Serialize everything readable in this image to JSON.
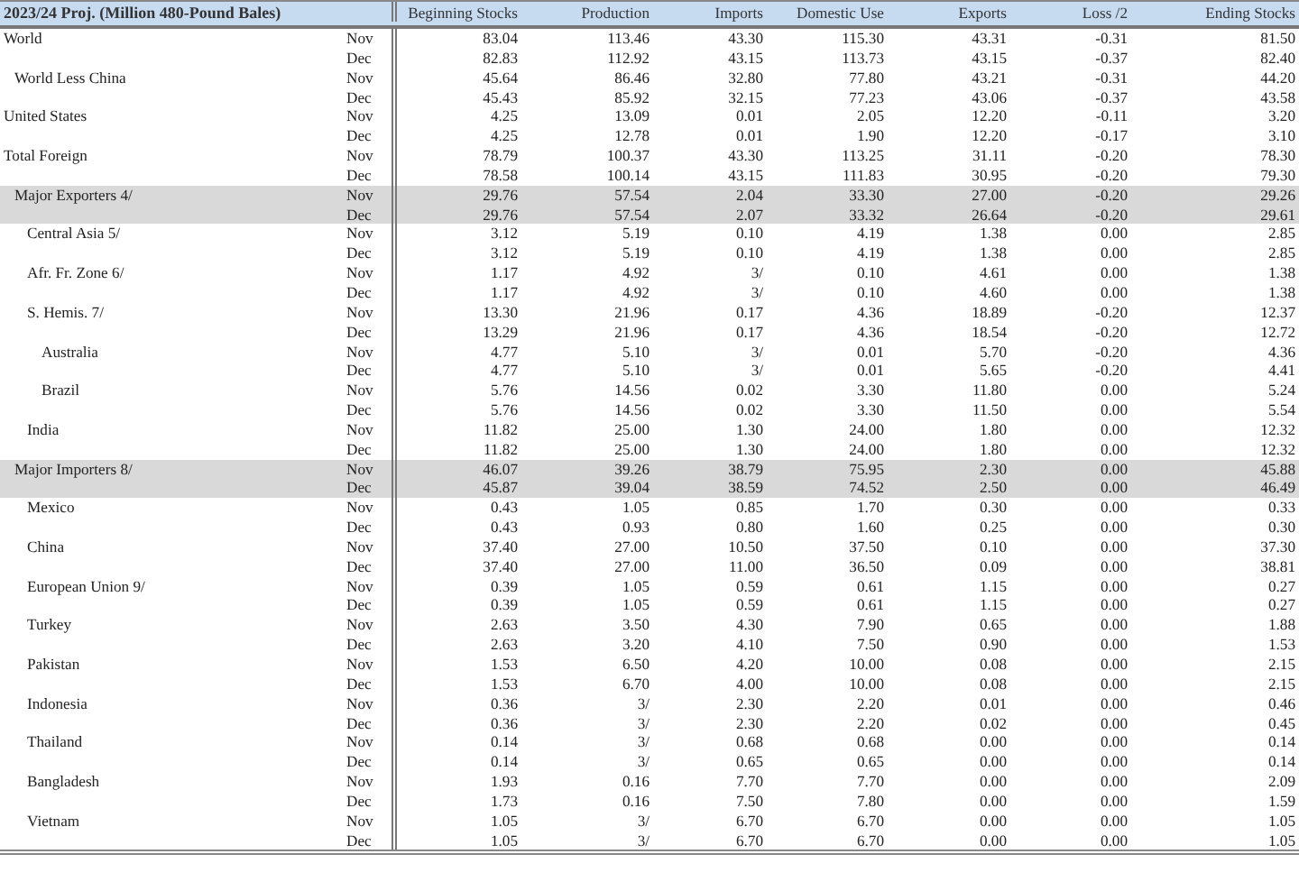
{
  "table": {
    "title": "2023/24 Proj. (Million 480-Pound Bales)",
    "columns": [
      "Beginning Stocks",
      "Production",
      "Imports",
      "Domestic Use",
      "Exports",
      "Loss /2",
      "Ending Stocks"
    ],
    "groups": [
      {
        "name": "World",
        "highlighted": false,
        "rows": [
          {
            "month": "Nov",
            "values": [
              "83.04",
              "113.46",
              "43.30",
              "115.30",
              "43.31",
              "-0.31",
              "81.50"
            ]
          },
          {
            "month": "Dec",
            "values": [
              "82.83",
              "112.92",
              "43.15",
              "113.73",
              "43.15",
              "-0.37",
              "82.40"
            ]
          }
        ],
        "children": [
          {
            "name": "World Less China",
            "highlighted": false,
            "rows": [
              {
                "month": "Nov",
                "values": [
                  "45.64",
                  "86.46",
                  "32.80",
                  "77.80",
                  "43.21",
                  "-0.31",
                  "44.20"
                ]
              },
              {
                "month": "Dec",
                "values": [
                  "45.43",
                  "85.92",
                  "32.15",
                  "77.23",
                  "43.06",
                  "-0.37",
                  "43.58"
                ]
              }
            ]
          }
        ]
      },
      {
        "name": "United States",
        "highlighted": false,
        "rows": [
          {
            "month": "Nov",
            "values": [
              "4.25",
              "13.09",
              "0.01",
              "2.05",
              "12.20",
              "-0.11",
              "3.20"
            ]
          },
          {
            "month": "Dec",
            "values": [
              "4.25",
              "12.78",
              "0.01",
              "1.90",
              "12.20",
              "-0.17",
              "3.10"
            ]
          }
        ]
      },
      {
        "name": "Total Foreign",
        "highlighted": false,
        "rows": [
          {
            "month": "Nov",
            "values": [
              "78.79",
              "100.37",
              "43.30",
              "113.25",
              "31.11",
              "-0.20",
              "78.30"
            ]
          },
          {
            "month": "Dec",
            "values": [
              "78.58",
              "100.14",
              "43.15",
              "111.83",
              "30.95",
              "-0.20",
              "79.30"
            ]
          }
        ],
        "children": [
          {
            "name": "Major Exporters  4/",
            "highlighted": true,
            "rows": [
              {
                "month": "Nov",
                "values": [
                  "29.76",
                  "57.54",
                  "2.04",
                  "33.30",
                  "27.00",
                  "-0.20",
                  "29.26"
                ]
              },
              {
                "month": "Dec",
                "values": [
                  "29.76",
                  "57.54",
                  "2.07",
                  "33.32",
                  "26.64",
                  "-0.20",
                  "29.61"
                ]
              }
            ],
            "children": [
              {
                "name": "Central Asia  5/",
                "highlighted": false,
                "rows": [
                  {
                    "month": "Nov",
                    "values": [
                      "3.12",
                      "5.19",
                      "0.10",
                      "4.19",
                      "1.38",
                      "0.00",
                      "2.85"
                    ]
                  },
                  {
                    "month": "Dec",
                    "values": [
                      "3.12",
                      "5.19",
                      "0.10",
                      "4.19",
                      "1.38",
                      "0.00",
                      "2.85"
                    ]
                  }
                ]
              },
              {
                "name": "Afr. Fr. Zone  6/",
                "highlighted": false,
                "rows": [
                  {
                    "month": "Nov",
                    "values": [
                      "1.17",
                      "4.92",
                      "3/",
                      "0.10",
                      "4.61",
                      "0.00",
                      "1.38"
                    ]
                  },
                  {
                    "month": "Dec",
                    "values": [
                      "1.17",
                      "4.92",
                      "3/",
                      "0.10",
                      "4.60",
                      "0.00",
                      "1.38"
                    ]
                  }
                ]
              },
              {
                "name": "S. Hemis.  7/",
                "highlighted": false,
                "rows": [
                  {
                    "month": "Nov",
                    "values": [
                      "13.30",
                      "21.96",
                      "0.17",
                      "4.36",
                      "18.89",
                      "-0.20",
                      "12.37"
                    ]
                  },
                  {
                    "month": "Dec",
                    "values": [
                      "13.29",
                      "21.96",
                      "0.17",
                      "4.36",
                      "18.54",
                      "-0.20",
                      "12.72"
                    ]
                  }
                ],
                "children": [
                  {
                    "name": "Australia",
                    "highlighted": false,
                    "rows": [
                      {
                        "month": "Nov",
                        "values": [
                          "4.77",
                          "5.10",
                          "3/",
                          "0.01",
                          "5.70",
                          "-0.20",
                          "4.36"
                        ]
                      },
                      {
                        "month": "Dec",
                        "values": [
                          "4.77",
                          "5.10",
                          "3/",
                          "0.01",
                          "5.65",
                          "-0.20",
                          "4.41"
                        ]
                      }
                    ]
                  },
                  {
                    "name": "Brazil",
                    "highlighted": false,
                    "rows": [
                      {
                        "month": "Nov",
                        "values": [
                          "5.76",
                          "14.56",
                          "0.02",
                          "3.30",
                          "11.80",
                          "0.00",
                          "5.24"
                        ]
                      },
                      {
                        "month": "Dec",
                        "values": [
                          "5.76",
                          "14.56",
                          "0.02",
                          "3.30",
                          "11.50",
                          "0.00",
                          "5.54"
                        ]
                      }
                    ]
                  }
                ]
              },
              {
                "name": "India",
                "highlighted": false,
                "rows": [
                  {
                    "month": "Nov",
                    "values": [
                      "11.82",
                      "25.00",
                      "1.30",
                      "24.00",
                      "1.80",
                      "0.00",
                      "12.32"
                    ]
                  },
                  {
                    "month": "Dec",
                    "values": [
                      "11.82",
                      "25.00",
                      "1.30",
                      "24.00",
                      "1.80",
                      "0.00",
                      "12.32"
                    ]
                  }
                ]
              }
            ]
          },
          {
            "name": "Major Importers  8/",
            "highlighted": true,
            "rows": [
              {
                "month": "Nov",
                "values": [
                  "46.07",
                  "39.26",
                  "38.79",
                  "75.95",
                  "2.30",
                  "0.00",
                  "45.88"
                ]
              },
              {
                "month": "Dec",
                "values": [
                  "45.87",
                  "39.04",
                  "38.59",
                  "74.52",
                  "2.50",
                  "0.00",
                  "46.49"
                ]
              }
            ],
            "children": [
              {
                "name": "Mexico",
                "highlighted": false,
                "rows": [
                  {
                    "month": "Nov",
                    "values": [
                      "0.43",
                      "1.05",
                      "0.85",
                      "1.70",
                      "0.30",
                      "0.00",
                      "0.33"
                    ]
                  },
                  {
                    "month": "Dec",
                    "values": [
                      "0.43",
                      "0.93",
                      "0.80",
                      "1.60",
                      "0.25",
                      "0.00",
                      "0.30"
                    ]
                  }
                ]
              },
              {
                "name": "China",
                "highlighted": false,
                "rows": [
                  {
                    "month": "Nov",
                    "values": [
                      "37.40",
                      "27.00",
                      "10.50",
                      "37.50",
                      "0.10",
                      "0.00",
                      "37.30"
                    ]
                  },
                  {
                    "month": "Dec",
                    "values": [
                      "37.40",
                      "27.00",
                      "11.00",
                      "36.50",
                      "0.09",
                      "0.00",
                      "38.81"
                    ]
                  }
                ]
              },
              {
                "name": "European Union  9/",
                "highlighted": false,
                "rows": [
                  {
                    "month": "Nov",
                    "values": [
                      "0.39",
                      "1.05",
                      "0.59",
                      "0.61",
                      "1.15",
                      "0.00",
                      "0.27"
                    ]
                  },
                  {
                    "month": "Dec",
                    "values": [
                      "0.39",
                      "1.05",
                      "0.59",
                      "0.61",
                      "1.15",
                      "0.00",
                      "0.27"
                    ]
                  }
                ]
              },
              {
                "name": "Turkey",
                "highlighted": false,
                "rows": [
                  {
                    "month": "Nov",
                    "values": [
                      "2.63",
                      "3.50",
                      "4.30",
                      "7.90",
                      "0.65",
                      "0.00",
                      "1.88"
                    ]
                  },
                  {
                    "month": "Dec",
                    "values": [
                      "2.63",
                      "3.20",
                      "4.10",
                      "7.50",
                      "0.90",
                      "0.00",
                      "1.53"
                    ]
                  }
                ]
              },
              {
                "name": "Pakistan",
                "highlighted": false,
                "rows": [
                  {
                    "month": "Nov",
                    "values": [
                      "1.53",
                      "6.50",
                      "4.20",
                      "10.00",
                      "0.08",
                      "0.00",
                      "2.15"
                    ]
                  },
                  {
                    "month": "Dec",
                    "values": [
                      "1.53",
                      "6.70",
                      "4.00",
                      "10.00",
                      "0.08",
                      "0.00",
                      "2.15"
                    ]
                  }
                ]
              },
              {
                "name": "Indonesia",
                "highlighted": false,
                "rows": [
                  {
                    "month": "Nov",
                    "values": [
                      "0.36",
                      "3/",
                      "2.30",
                      "2.20",
                      "0.01",
                      "0.00",
                      "0.46"
                    ]
                  },
                  {
                    "month": "Dec",
                    "values": [
                      "0.36",
                      "3/",
                      "2.30",
                      "2.20",
                      "0.02",
                      "0.00",
                      "0.45"
                    ]
                  }
                ]
              },
              {
                "name": "Thailand",
                "highlighted": false,
                "rows": [
                  {
                    "month": "Nov",
                    "values": [
                      "0.14",
                      "3/",
                      "0.68",
                      "0.68",
                      "0.00",
                      "0.00",
                      "0.14"
                    ]
                  },
                  {
                    "month": "Dec",
                    "values": [
                      "0.14",
                      "3/",
                      "0.65",
                      "0.65",
                      "0.00",
                      "0.00",
                      "0.14"
                    ]
                  }
                ]
              },
              {
                "name": "Bangladesh",
                "highlighted": false,
                "rows": [
                  {
                    "month": "Nov",
                    "values": [
                      "1.93",
                      "0.16",
                      "7.70",
                      "7.70",
                      "0.00",
                      "0.00",
                      "2.09"
                    ]
                  },
                  {
                    "month": "Dec",
                    "values": [
                      "1.73",
                      "0.16",
                      "7.50",
                      "7.80",
                      "0.00",
                      "0.00",
                      "1.59"
                    ]
                  }
                ]
              },
              {
                "name": "Vietnam",
                "highlighted": false,
                "rows": [
                  {
                    "month": "Nov",
                    "values": [
                      "1.05",
                      "3/",
                      "6.70",
                      "6.70",
                      "0.00",
                      "0.00",
                      "1.05"
                    ]
                  },
                  {
                    "month": "Dec",
                    "values": [
                      "1.05",
                      "3/",
                      "6.70",
                      "6.70",
                      "0.00",
                      "0.00",
                      "1.05"
                    ]
                  }
                ]
              }
            ]
          }
        ]
      }
    ]
  }
}
